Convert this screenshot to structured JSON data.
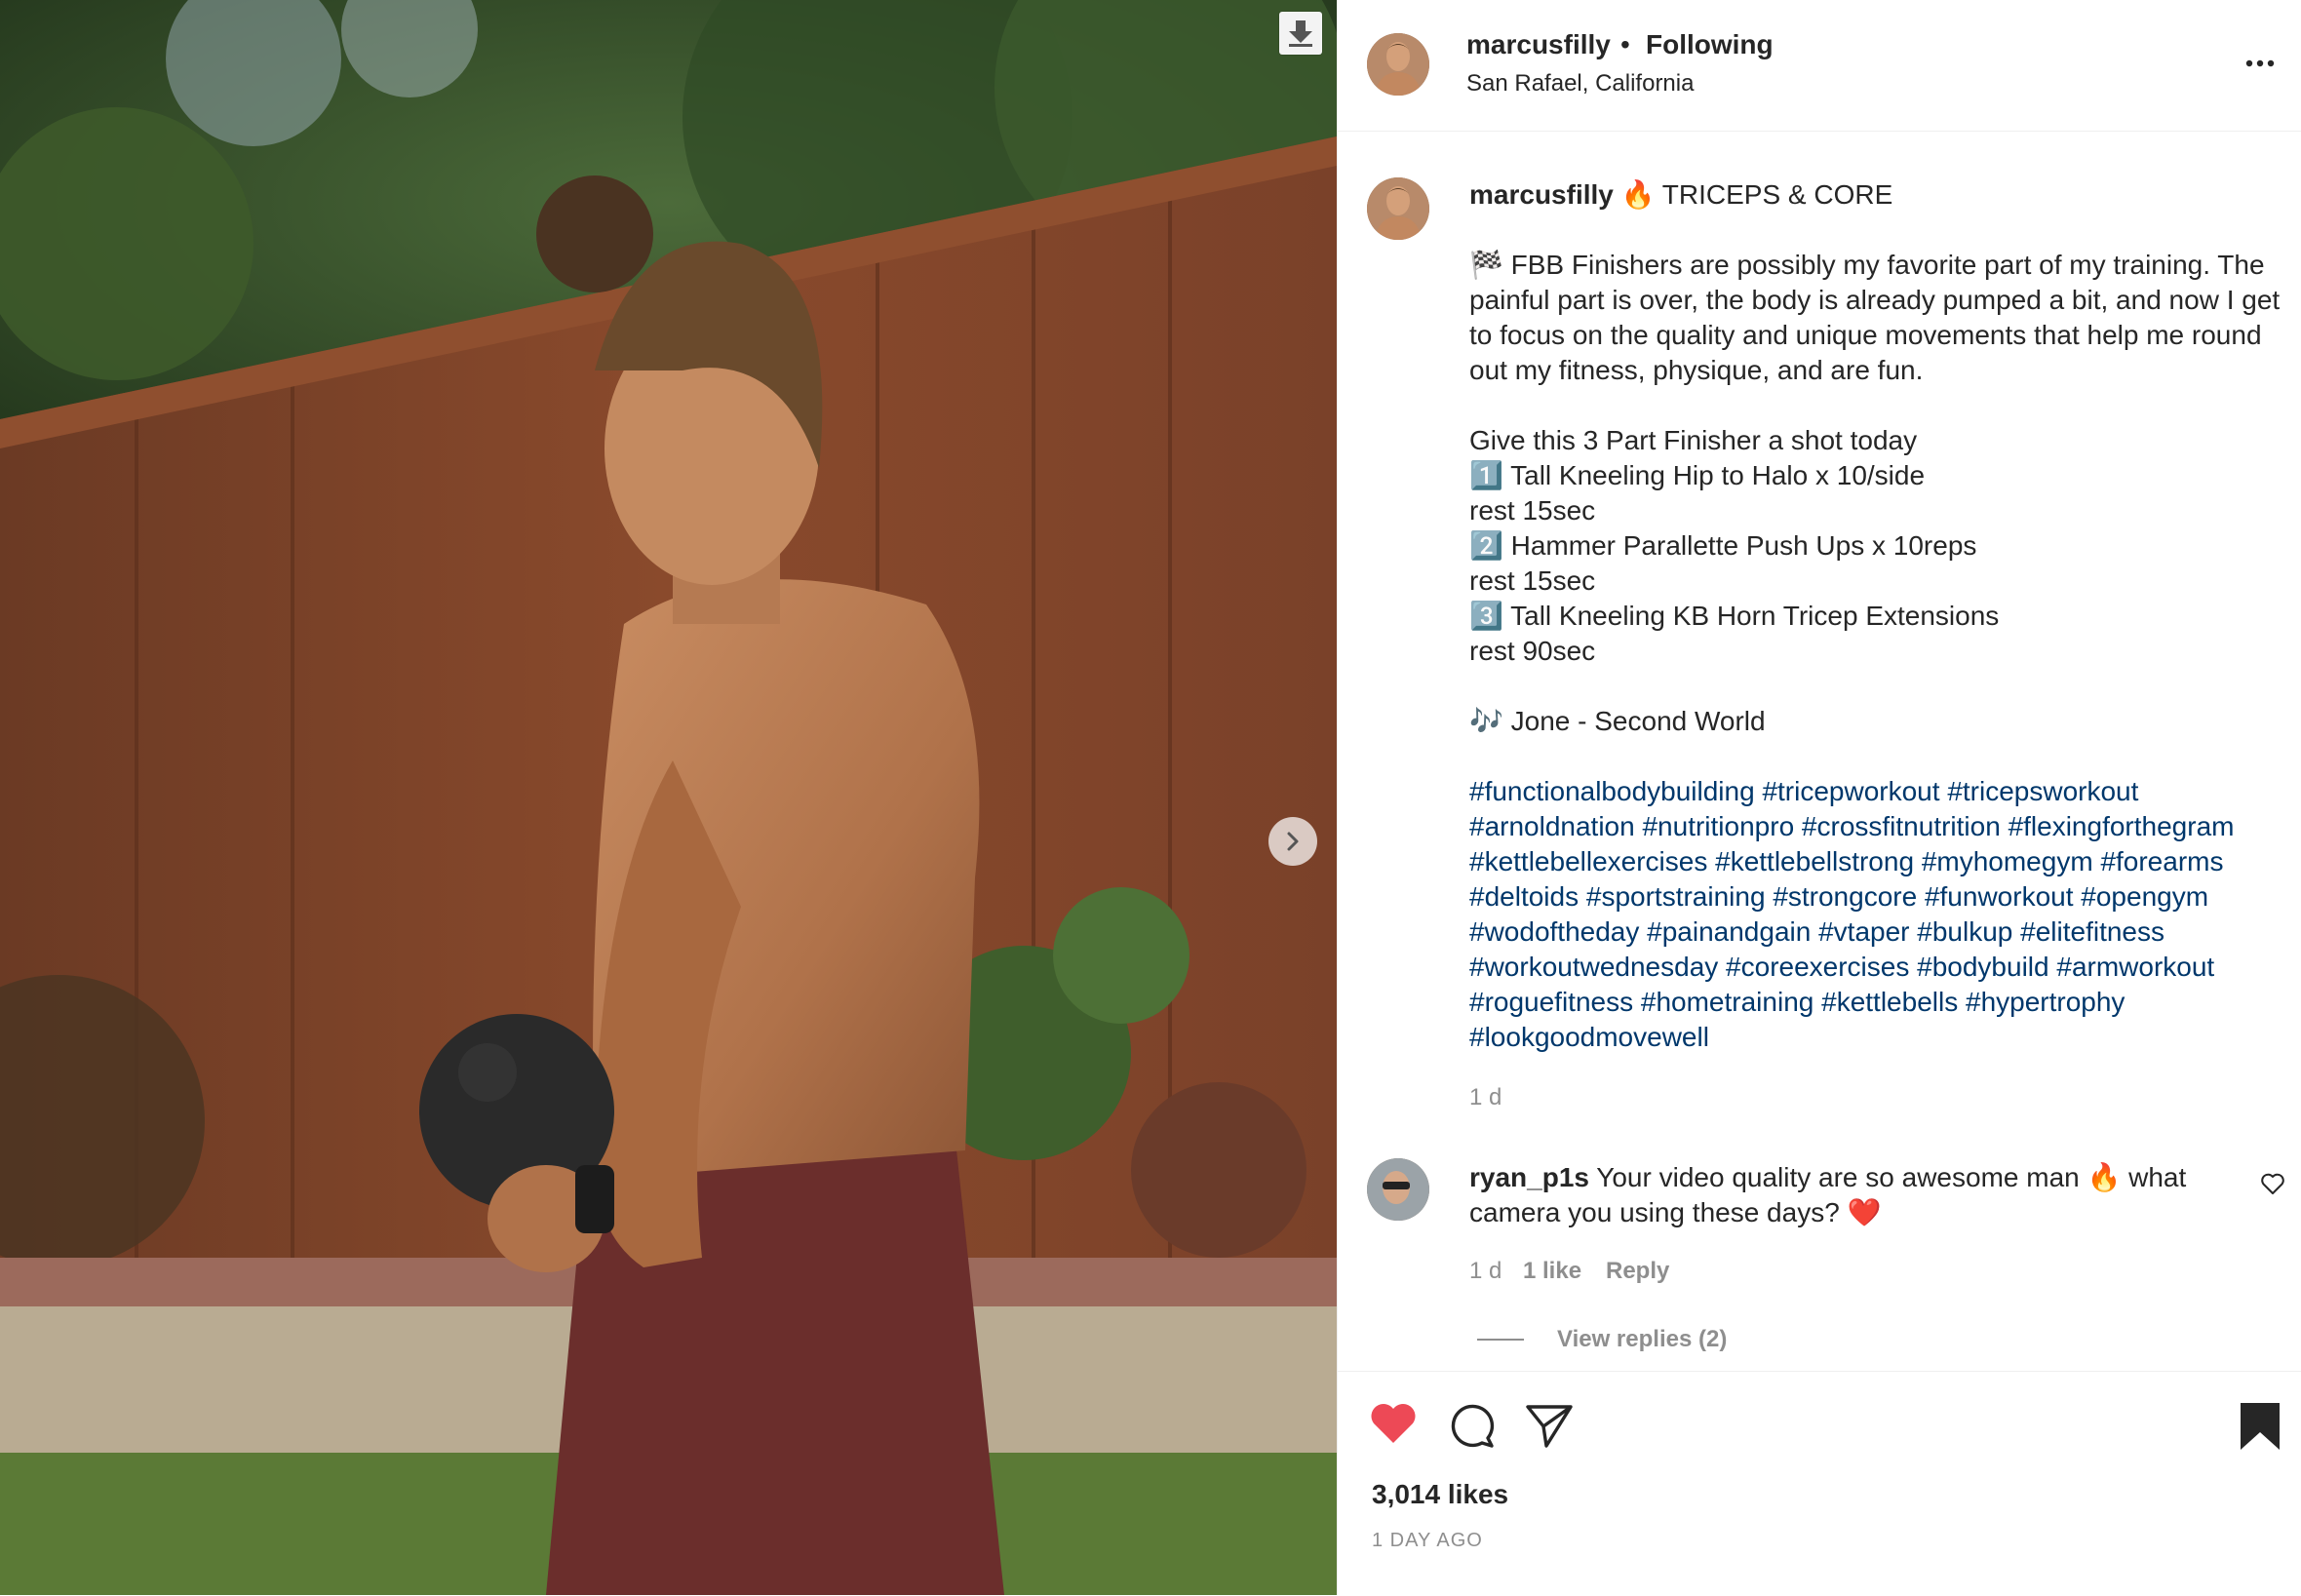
{
  "post": {
    "username": "marcusfilly",
    "separator": "•",
    "follow_status": "Following",
    "location": "San Rafael, California",
    "media_alt": "Shirtless athlete with top-knot hair holding a black kettlebell in a backyard in front of a wooden fence"
  },
  "caption": {
    "username": "marcusfilly",
    "title": "🔥 TRICEPS & CORE",
    "paragraph1": "🏁 FBB Finishers are possibly my favorite part of my training. The painful part is over, the body is already pumped a bit, and now I get to focus on the quality and unique movements that help me round out my fitness, physique, and are fun.",
    "intro": "Give this 3 Part Finisher a shot today",
    "steps": [
      "1️⃣ Tall Kneeling Hip to Halo x 10/side",
      "rest 15sec",
      "2️⃣ Hammer Parallette Push Ups x 10reps",
      "rest 15sec",
      "3️⃣ Tall Kneeling KB Horn Tricep Extensions",
      "rest 90sec"
    ],
    "music": "🎶 Jone - Second World",
    "hashtags": [
      "#functionalbodybuilding",
      "#tricepworkout",
      "#tricepsworkout",
      "#arnoldnation",
      "#nutritionpro",
      "#crossfitnutrition",
      "#flexingforthegram",
      "#kettlebellexercises",
      "#kettlebellstrong",
      "#myhomegym",
      "#forearms",
      "#deltoids",
      "#sportstraining",
      "#strongcore",
      "#funworkout",
      "#opengym",
      "#wodoftheday",
      "#painandgain",
      "#vtaper",
      "#bulkup",
      "#elitefitness",
      "#workoutwednesday",
      "#coreexercises",
      "#bodybuild",
      "#armworkout",
      "#roguefitness",
      "#hometraining",
      "#kettlebells",
      "#hypertrophy",
      "#lookgoodmovewell"
    ],
    "time": "1 d"
  },
  "comment": {
    "username": "ryan_p1s",
    "text": "Your video quality are so awesome man 🔥 what camera you using these days? ❤️",
    "time": "1 d",
    "likes": "1 like",
    "reply": "Reply",
    "view_replies": "View replies (2)"
  },
  "footer": {
    "likes": "3,014 likes",
    "posted": "1 DAY AGO"
  },
  "icons": {
    "download": "download-icon",
    "next": "chevron-right-icon",
    "more": "more-options-icon",
    "like": "heart-filled-icon",
    "comment": "comment-icon",
    "share": "share-icon",
    "save": "bookmark-filled-icon",
    "comment_like": "heart-outline-icon"
  },
  "colors": {
    "like_red": "#ed4956",
    "hashtag_blue": "#00376b",
    "muted_gray": "#8e8e8e",
    "text": "#262626"
  }
}
